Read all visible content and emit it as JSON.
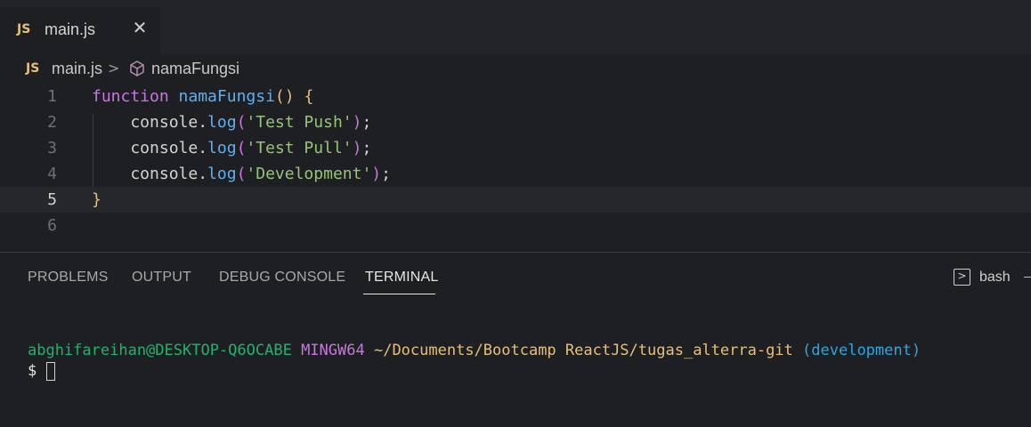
{
  "tab": {
    "icon": "javascript-file-icon",
    "badge": "JS",
    "label": "main.js",
    "close_icon": "close-icon"
  },
  "breadcrumb": {
    "badge": "JS",
    "file": "main.js",
    "separator": ">",
    "symbol_icon": "cube-symbol-icon",
    "symbol": "namaFungsi"
  },
  "editor": {
    "current_line": 5,
    "lines": [
      {
        "number": "1",
        "tokens": [
          {
            "t": "function",
            "c": "kw"
          },
          {
            "t": " ",
            "c": "obj"
          },
          {
            "t": "namaFungsi",
            "c": "fn"
          },
          {
            "t": "()",
            "c": "par"
          },
          {
            "t": " ",
            "c": "obj"
          },
          {
            "t": "{",
            "c": "par"
          }
        ]
      },
      {
        "number": "2",
        "tokens": [
          {
            "t": "    console.",
            "c": "obj"
          },
          {
            "t": "log",
            "c": "fn"
          },
          {
            "t": "(",
            "c": "par2"
          },
          {
            "t": "'Test Push'",
            "c": "str"
          },
          {
            "t": ")",
            "c": "par2"
          },
          {
            "t": ";",
            "c": "obj"
          }
        ]
      },
      {
        "number": "3",
        "tokens": [
          {
            "t": "    console.",
            "c": "obj"
          },
          {
            "t": "log",
            "c": "fn"
          },
          {
            "t": "(",
            "c": "par2"
          },
          {
            "t": "'Test Pull'",
            "c": "str"
          },
          {
            "t": ")",
            "c": "par2"
          },
          {
            "t": ";",
            "c": "obj"
          }
        ]
      },
      {
        "number": "4",
        "tokens": [
          {
            "t": "    console.",
            "c": "obj"
          },
          {
            "t": "log",
            "c": "fn"
          },
          {
            "t": "(",
            "c": "par2"
          },
          {
            "t": "'Development'",
            "c": "str"
          },
          {
            "t": ")",
            "c": "par2"
          },
          {
            "t": ";",
            "c": "obj"
          }
        ]
      },
      {
        "number": "5",
        "tokens": [
          {
            "t": "}",
            "c": "par"
          }
        ]
      },
      {
        "number": "6",
        "tokens": []
      }
    ]
  },
  "panel": {
    "tabs": [
      "PROBLEMS",
      "OUTPUT",
      "DEBUG CONSOLE",
      "TERMINAL"
    ],
    "active_tab": "TERMINAL",
    "shell_icon": "terminal-icon",
    "shell": "bash"
  },
  "terminal": {
    "user": "abghifareihan@DESKTOP-Q6OCABE",
    "system": "MINGW64",
    "path": "~/Documents/Bootcamp ReactJS/tugas_alterra-git",
    "branch": "(development)",
    "prompt": "$"
  },
  "colors": {
    "background": "#1e1f22",
    "keyword": "#c678dd",
    "function": "#61afef",
    "string": "#98c379",
    "bracket": "#e5c07b",
    "terminal_user": "#23b26d",
    "terminal_branch": "#2aa7e0"
  }
}
